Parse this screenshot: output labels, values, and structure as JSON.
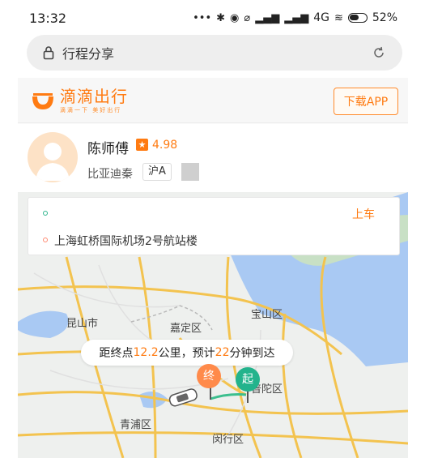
{
  "status_bar": {
    "time": "13:32",
    "network": "4G",
    "battery": "52%"
  },
  "browser": {
    "title": "行程分享"
  },
  "header": {
    "logo_name": "滴滴出行",
    "logo_tagline": "滴滴一下 美好出行",
    "download_button": "下载APP",
    "brand_color": "#ff7b12"
  },
  "driver": {
    "name": "陈师傅",
    "rating": "4.98",
    "car_model": "比亚迪秦",
    "plate": "沪A"
  },
  "route": {
    "pickup_action": "上车",
    "dropoff": "上海虹桥国际机场2号航站楼"
  },
  "eta": {
    "prefix": "距终点",
    "distance": "12.2",
    "mid": "公里，预计",
    "minutes": "22",
    "suffix": "分钟到达"
  },
  "map": {
    "labels": {
      "kunshan": "昆山市",
      "baoshan": "宝山区",
      "jiading": "嘉定区",
      "putuo": "普陀区",
      "qingpu": "青浦区",
      "minhang": "闵行区"
    },
    "pins": {
      "end": "终",
      "start": "起"
    }
  }
}
